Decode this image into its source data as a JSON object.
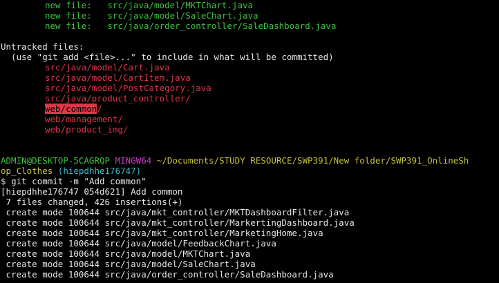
{
  "staged_tail": [
    {
      "status": "new file:",
      "path": "src/java/model/MKTChart.java"
    },
    {
      "status": "new file:",
      "path": "src/java/model/SaleChart.java"
    },
    {
      "status": "new file:",
      "path": "src/java/order_controller/SaleDashboard.java"
    }
  ],
  "untracked": {
    "header": "Untracked files:",
    "hint": "  (use \"git add <file>...\" to include in what will be committed)",
    "files": [
      "src/java/model/Cart.java",
      "src/java/model/CartItem.java",
      "src/java/model/PostCategory.java",
      "src/java/product_controller/"
    ],
    "highlighted": {
      "selected": "web/common",
      "rest": "/"
    },
    "files_after": [
      "web/management/",
      "web/product_img/"
    ]
  },
  "prompt": {
    "user_host": "ADMIN@DESKTOP-5CAGRQP",
    "shell": "MINGW64",
    "cwd_line1": "~/Documents/STUDY RESOURCE/SWP391/New folder/SWP391_OnlineSh",
    "cwd_line2": "op_Clothes",
    "branch": "(hiepdhhe176747)",
    "symbol": "$",
    "command": "git commit -m \"Add common\""
  },
  "commit_output": {
    "summary": "[hiepdhhe176747 054d621] Add common",
    "stats": " 7 files changed, 426 insertions(+)",
    "creates": [
      " create mode 100644 src/java/mkt_controller/MKTDashboardFilter.java",
      " create mode 100644 src/java/mkt_controller/MarkertingDashboard.java",
      " create mode 100644 src/java/mkt_controller/MarketingHome.java",
      " create mode 100644 src/java/model/FeedbackChart.java",
      " create mode 100644 src/java/model/MKTChart.java",
      " create mode 100644 src/java/model/SaleChart.java",
      " create mode 100644 src/java/order_controller/SaleDashboard.java"
    ]
  },
  "colors": {
    "background": "#000000",
    "staged": "#3ec23e",
    "untracked": "#e0364a",
    "user_host": "#3ec23e",
    "shell": "#c63ec6",
    "cwd": "#c8c23c",
    "branch": "#3fb8c8",
    "text": "#e6e6e6"
  }
}
